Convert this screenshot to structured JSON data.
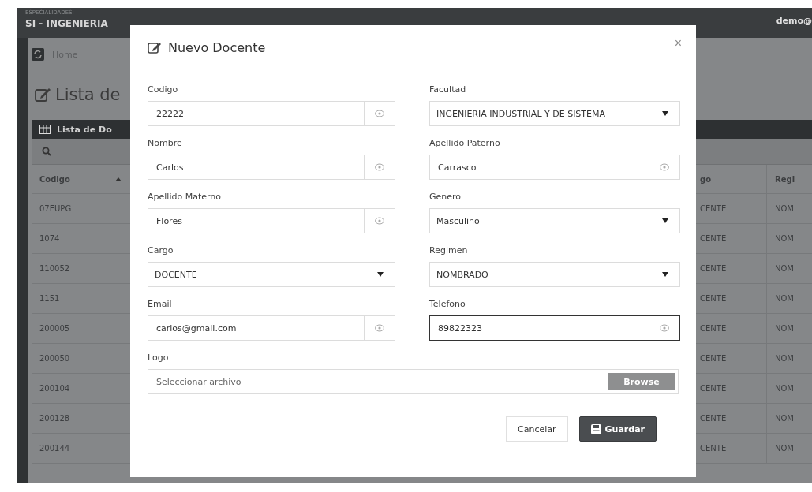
{
  "topbar": {
    "subtitle": "ESPECIALIDADES:",
    "title": "SI - INGENIERIA",
    "user": "demo@"
  },
  "breadcrumb": {
    "label": "Home"
  },
  "page_title": "Lista de",
  "panel": {
    "title": "Lista de Do"
  },
  "table": {
    "columns": [
      {
        "label": "Codigo",
        "sorted": true
      },
      {
        "label": "go",
        "sorted": false
      },
      {
        "label": "Regi",
        "sorted": false
      }
    ],
    "rows": [
      [
        "07EUPG",
        "CENTE",
        "NOM"
      ],
      [
        "1074",
        "CENTE",
        "NOM"
      ],
      [
        "110052",
        "CENTE",
        "NOM"
      ],
      [
        "1151",
        "CENTE",
        "NOM"
      ],
      [
        "200005",
        "CENTE",
        "NOM"
      ],
      [
        "200050",
        "CENTE",
        "NOM"
      ],
      [
        "200104",
        "CENTE",
        "NOM"
      ],
      [
        "200128",
        "CENTE",
        "NOM"
      ],
      [
        "200144",
        "CENTE",
        "NOM"
      ]
    ]
  },
  "modal": {
    "title": "Nuevo Docente",
    "close": "×",
    "fields": [
      {
        "label": "Codigo",
        "value": "22222",
        "kind": "text",
        "focused": false
      },
      {
        "label": "Facultad",
        "value": "INGENIERIA INDUSTRIAL Y DE SISTEMA",
        "kind": "select",
        "focused": false
      },
      {
        "label": "Nombre",
        "value": "Carlos",
        "kind": "text",
        "focused": false
      },
      {
        "label": "Apellido Paterno",
        "value": "Carrasco",
        "kind": "text",
        "focused": false
      },
      {
        "label": "Apellido Materno",
        "value": "Flores",
        "kind": "text",
        "focused": false
      },
      {
        "label": "Genero",
        "value": "Masculino",
        "kind": "select",
        "focused": false
      },
      {
        "label": "Cargo",
        "value": "DOCENTE",
        "kind": "select",
        "focused": false
      },
      {
        "label": "Regimen",
        "value": "NOMBRADO",
        "kind": "select",
        "focused": false
      },
      {
        "label": "Email",
        "value": "carlos@gmail.com",
        "kind": "text",
        "focused": false
      },
      {
        "label": "Telefono",
        "value": "89822323",
        "kind": "text",
        "focused": true
      }
    ],
    "logo": {
      "label": "Logo",
      "placeholder": "Seleccionar archivo",
      "button": "Browse"
    },
    "buttons": [
      {
        "label": "Cancelar",
        "kind": "secondary"
      },
      {
        "label": "Guardar",
        "kind": "primary"
      }
    ]
  }
}
